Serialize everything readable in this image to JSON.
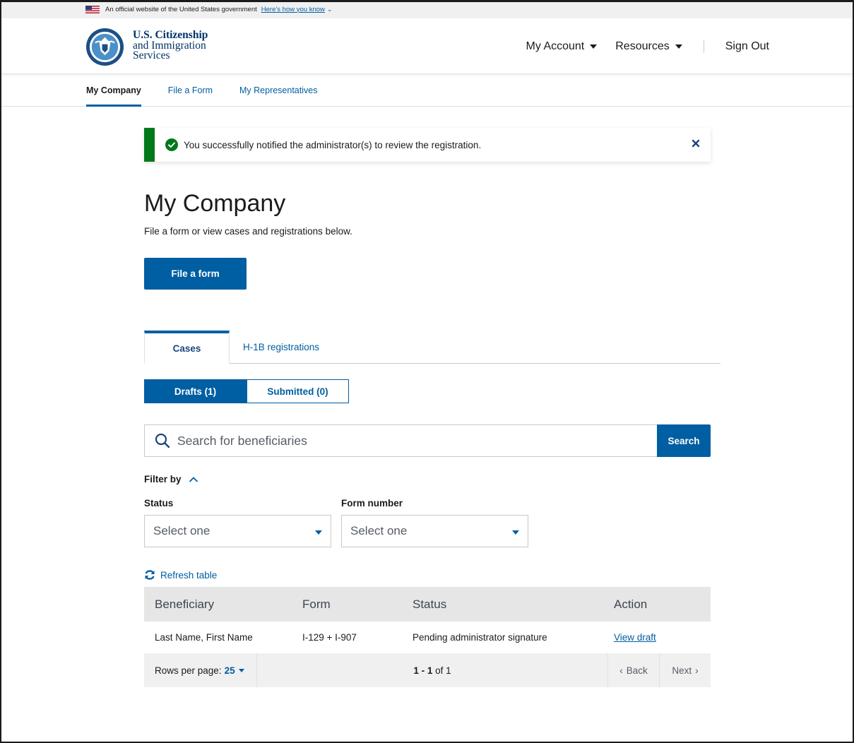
{
  "gov_banner": {
    "text": "An official website of the United States government",
    "link": "Here’s how you know"
  },
  "header": {
    "brand_line1": "U.S. Citizenship",
    "brand_line2": "and Immigration",
    "brand_line3": "Services",
    "my_account": "My Account",
    "resources": "Resources",
    "sign_out": "Sign Out"
  },
  "subnav": {
    "items": [
      {
        "label": "My Company",
        "active": true
      },
      {
        "label": "File a Form",
        "active": false
      },
      {
        "label": "My Representatives",
        "active": false
      }
    ]
  },
  "alert": {
    "message": "You successfully notified the administrator(s) to review the registration."
  },
  "page": {
    "title": "My Company",
    "subtitle": "File a form or view cases and registrations below.",
    "file_button": "File a form"
  },
  "tabs": [
    {
      "label": "Cases",
      "active": true
    },
    {
      "label": "H-1B registrations",
      "active": false
    }
  ],
  "segments": [
    {
      "label": "Drafts (1)",
      "active": true
    },
    {
      "label": "Submitted (0)",
      "active": false
    }
  ],
  "search": {
    "placeholder": "Search for beneficiaries",
    "button": "Search"
  },
  "filter": {
    "label": "Filter by",
    "status_label": "Status",
    "status_value": "Select one",
    "form_label": "Form number",
    "form_value": "Select one"
  },
  "refresh_label": "Refresh table",
  "table": {
    "headers": [
      "Beneficiary",
      "Form",
      "Status",
      "Action"
    ],
    "rows": [
      {
        "beneficiary": "Last Name, First Name",
        "form": "I-129 + I-907",
        "status": "Pending administrator signature",
        "action": "View draft"
      }
    ]
  },
  "pagination": {
    "rows_label": "Rows per page:",
    "rows_value": "25",
    "range_bold": "1 - 1",
    "range_rest": "of 1",
    "back": "Back",
    "next": "Next"
  },
  "colors": {
    "primary": "#005ea2",
    "success": "#00791a"
  }
}
